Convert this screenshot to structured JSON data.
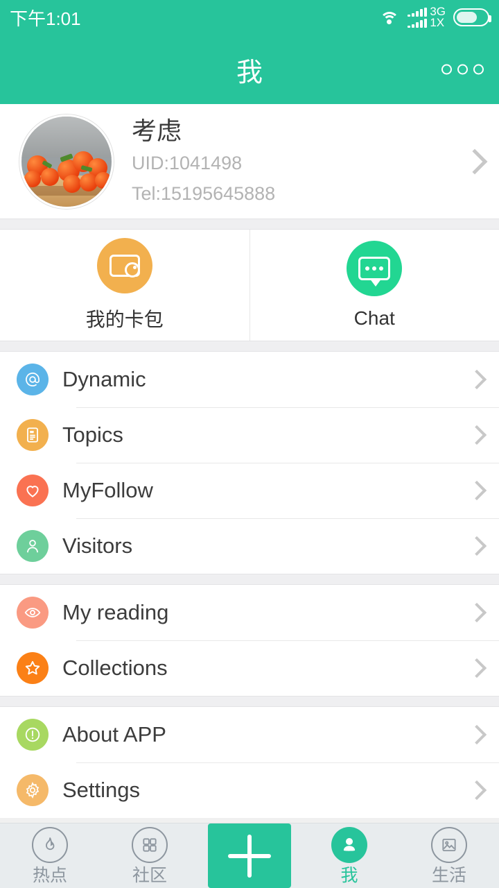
{
  "statusbar": {
    "time": "下午1:01",
    "wifi_icon": "wifi-icon",
    "network_top": "3G",
    "network_bottom": "1X",
    "battery_icon": "battery-icon"
  },
  "header": {
    "title": "我",
    "more_icon": "more-options-icon",
    "background_color": "#27c49b"
  },
  "profile": {
    "avatar_icon": "user-avatar-photo",
    "name": "考虑",
    "uid": "UID:1041498",
    "tel": "Tel:15195645888",
    "chevron_icon": "chevron-right-icon"
  },
  "quick_actions": [
    {
      "label": "我的卡包",
      "icon": "wallet-icon",
      "color": "#f2b04e"
    },
    {
      "label": "Chat",
      "icon": "chat-bubble-icon",
      "color": "#22d692"
    }
  ],
  "menu_groups": [
    {
      "items": [
        {
          "label": "Dynamic",
          "icon": "at-sign-icon",
          "color": "#5bb4e8"
        },
        {
          "label": "Topics",
          "icon": "document-icon",
          "color": "#f2b04e"
        },
        {
          "label": "MyFollow",
          "icon": "heart-icon",
          "color": "#fa7252"
        },
        {
          "label": "Visitors",
          "icon": "person-icon",
          "color": "#6ecf9b"
        }
      ]
    },
    {
      "items": [
        {
          "label": "My reading",
          "icon": "eye-icon",
          "color": "#fa9a82"
        },
        {
          "label": "Collections",
          "icon": "star-icon",
          "color": "#fb8016"
        }
      ]
    },
    {
      "items": [
        {
          "label": "About APP",
          "icon": "exclamation-circle-icon",
          "color": "#a8d861"
        },
        {
          "label": "Settings",
          "icon": "gear-icon",
          "color": "#f5b969"
        }
      ]
    }
  ],
  "tabbar": {
    "items": [
      {
        "label": "热点",
        "icon": "flame-icon",
        "active": false
      },
      {
        "label": "社区",
        "icon": "grid-icon",
        "active": false
      },
      {
        "label": "我",
        "icon": "person-icon",
        "active": true
      },
      {
        "label": "生活",
        "icon": "image-icon",
        "active": false
      }
    ],
    "center_button_icon": "plus-icon",
    "active_color": "#27c49b",
    "inactive_color": "#8d969f"
  }
}
